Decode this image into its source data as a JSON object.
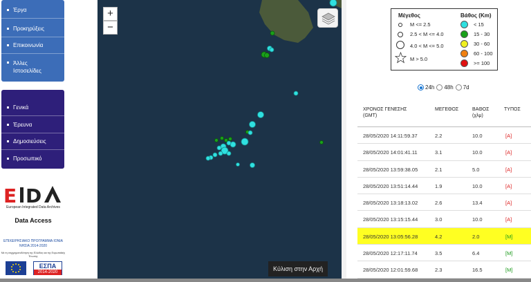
{
  "sidebar": {
    "menu_top": [
      {
        "label": "Έργα"
      },
      {
        "label": "Προκηρύξεις"
      },
      {
        "label": "Επικοινωνία"
      },
      {
        "label": "Άλλες Ιστοσελίδες"
      }
    ],
    "menu_bottom": [
      {
        "label": "Γενικά"
      },
      {
        "label": "Έρευνα"
      },
      {
        "label": "Δημοσιεύσεις"
      },
      {
        "label": "Προσωπικό"
      }
    ],
    "eida_sub": "European Integrated Data Archives",
    "data_access": "Data Access",
    "program_title": "ΕΠΙΧΕΙΡΗΣΙΑΚΟ ΠΡΟΓΡΑΜΜΑ ΙΟΝΙΑ ΝΗΣΙΑ 2014-2020",
    "program_sub": "Με τη συγχρηματοδότηση της Ελλάδας και της Ευρωπαϊκής Ένωσης",
    "espa_label": "ΕΣΠΑ",
    "espa_years": "2014-2020"
  },
  "map": {
    "zoom_in": "+",
    "zoom_out": "−",
    "scroll_top_label": "Κύλιση στην Αρχή",
    "sea_color": "#1c3348",
    "land_color": "#4b5a3a"
  },
  "legend": {
    "magnitude_title": "Μέγεθος",
    "depth_title": "Βάθος (Km)",
    "magnitudes": [
      "M <= 2.5",
      "2.5 < M <= 4.0",
      "4.0 < M <= 5.0",
      "M > 5.0"
    ],
    "depths": [
      {
        "label": "< 15",
        "color": "#2fe0e0"
      },
      {
        "label": "15 - 30",
        "color": "#1aa01a"
      },
      {
        "label": "30 - 60",
        "color": "#f0f020"
      },
      {
        "label": "60 - 100",
        "color": "#f08010"
      },
      {
        "label": ">= 100",
        "color": "#e01010"
      }
    ]
  },
  "time_filter": {
    "options": [
      "24h",
      "48h",
      "7d"
    ],
    "selected": "24h"
  },
  "table": {
    "headers": {
      "time": "ΧΡΟΝΟΣ ΓΕΝΕΣΗΣ",
      "time_sub": "(GMT)",
      "magnitude": "ΜΕΓΕΘΟΣ",
      "depth": "ΒΑΘΟΣ",
      "depth_sub": "(χλμ)",
      "type": "ΤΥΠΟΣ"
    },
    "rows": [
      {
        "time": "28/05/2020 14:11:59.37",
        "mag": "2.2",
        "depth": "10.0",
        "type": "[A]"
      },
      {
        "time": "28/05/2020 14:01:41.11",
        "mag": "3.1",
        "depth": "10.0",
        "type": "[A]"
      },
      {
        "time": "28/05/2020 13:59:38.05",
        "mag": "2.1",
        "depth": "5.0",
        "type": "[A]"
      },
      {
        "time": "28/05/2020 13:51:14.44",
        "mag": "1.9",
        "depth": "10.0",
        "type": "[A]"
      },
      {
        "time": "28/05/2020 13:18:13.02",
        "mag": "2.6",
        "depth": "13.4",
        "type": "[A]"
      },
      {
        "time": "28/05/2020 13:15:15.44",
        "mag": "3.0",
        "depth": "10.0",
        "type": "[A]"
      },
      {
        "time": "28/05/2020 13:05:56.28",
        "mag": "4.2",
        "depth": "2.0",
        "type": "[M]"
      },
      {
        "time": "28/05/2020 12:17:11.74",
        "mag": "3.5",
        "depth": "6.4",
        "type": "[M]"
      },
      {
        "time": "28/05/2020 12:01:59.68",
        "mag": "2.3",
        "depth": "16.5",
        "type": "[M]"
      }
    ],
    "highlighted_row": 6
  }
}
